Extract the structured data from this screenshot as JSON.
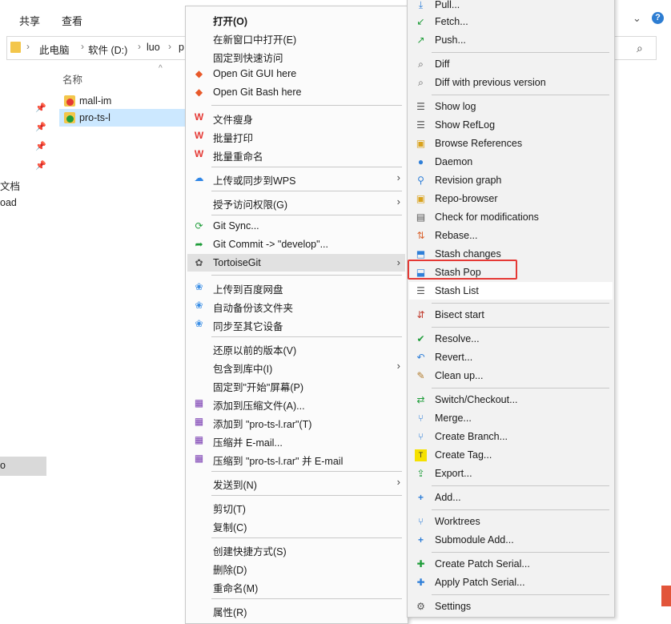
{
  "explorer": {
    "ribbon_tabs": [
      "共享",
      "查看"
    ],
    "breadcrumb": [
      "此电脑",
      "软件 (D:)",
      "luo",
      "p"
    ],
    "column_name": "名称",
    "files": [
      {
        "name": "mall-im",
        "selected": false,
        "badge": "#e53935"
      },
      {
        "name": "pro-ts-l",
        "selected": true,
        "badge": "#1f9d3a"
      }
    ],
    "nav_fragments": [
      "文档",
      "oad",
      "o"
    ]
  },
  "context_menu": {
    "items": [
      {
        "type": "item",
        "label": "打开(O)",
        "bold": true,
        "icon": "none"
      },
      {
        "type": "item",
        "label": "在新窗口中打开(E)",
        "icon": "none"
      },
      {
        "type": "item",
        "label": "固定到快速访问",
        "icon": "none"
      },
      {
        "type": "item",
        "label": "Open Git GUI here",
        "icon": "git-gui-icon"
      },
      {
        "type": "item",
        "label": "Open Git Bash here",
        "icon": "git-bash-icon"
      },
      {
        "type": "sep"
      },
      {
        "type": "item",
        "label": "文件瘦身",
        "icon": "wps-icon"
      },
      {
        "type": "item",
        "label": "批量打印",
        "icon": "wps-icon"
      },
      {
        "type": "item",
        "label": "批量重命名",
        "icon": "wps-icon"
      },
      {
        "type": "sep"
      },
      {
        "type": "item",
        "label": "上传或同步到WPS",
        "icon": "cloud-icon",
        "submenu": true
      },
      {
        "type": "sep"
      },
      {
        "type": "item",
        "label": "授予访问权限(G)",
        "icon": "none",
        "submenu": true
      },
      {
        "type": "sep"
      },
      {
        "type": "item",
        "label": "Git Sync...",
        "icon": "git-sync-icon"
      },
      {
        "type": "item",
        "label": "Git Commit -> \"develop\"...",
        "icon": "git-commit-icon"
      },
      {
        "type": "item",
        "label": "TortoiseGit",
        "icon": "tortoisegit-icon",
        "submenu": true,
        "highlighted": true
      },
      {
        "type": "sep"
      },
      {
        "type": "item",
        "label": "上传到百度网盘",
        "icon": "baidu-icon"
      },
      {
        "type": "item",
        "label": "自动备份该文件夹",
        "icon": "baidu-icon"
      },
      {
        "type": "item",
        "label": "同步至其它设备",
        "icon": "baidu-icon"
      },
      {
        "type": "sep"
      },
      {
        "type": "item",
        "label": "还原以前的版本(V)",
        "icon": "none"
      },
      {
        "type": "item",
        "label": "包含到库中(I)",
        "icon": "none",
        "submenu": true
      },
      {
        "type": "item",
        "label": "固定到\"开始\"屏幕(P)",
        "icon": "none"
      },
      {
        "type": "item",
        "label": "添加到压缩文件(A)...",
        "icon": "winrar-icon"
      },
      {
        "type": "item",
        "label": "添加到 \"pro-ts-l.rar\"(T)",
        "icon": "winrar-icon"
      },
      {
        "type": "item",
        "label": "压缩并 E-mail...",
        "icon": "winrar-icon"
      },
      {
        "type": "item",
        "label": "压缩到 \"pro-ts-l.rar\" 并 E-mail",
        "icon": "winrar-icon"
      },
      {
        "type": "sep"
      },
      {
        "type": "item",
        "label": "发送到(N)",
        "icon": "none",
        "submenu": true
      },
      {
        "type": "sep"
      },
      {
        "type": "item",
        "label": "剪切(T)",
        "icon": "none"
      },
      {
        "type": "item",
        "label": "复制(C)",
        "icon": "none"
      },
      {
        "type": "sep"
      },
      {
        "type": "item",
        "label": "创建快捷方式(S)",
        "icon": "none"
      },
      {
        "type": "item",
        "label": "删除(D)",
        "icon": "none"
      },
      {
        "type": "item",
        "label": "重命名(M)",
        "icon": "none"
      },
      {
        "type": "sep"
      },
      {
        "type": "item",
        "label": "属性(R)",
        "icon": "none"
      }
    ]
  },
  "tortoisegit_menu": {
    "items": [
      {
        "type": "item",
        "label": "Pull...",
        "icon": "pull-icon"
      },
      {
        "type": "item",
        "label": "Fetch...",
        "icon": "fetch-icon"
      },
      {
        "type": "item",
        "label": "Push...",
        "icon": "push-icon"
      },
      {
        "type": "sep"
      },
      {
        "type": "item",
        "label": "Diff",
        "icon": "diff-icon"
      },
      {
        "type": "item",
        "label": "Diff with previous version",
        "icon": "diff-icon"
      },
      {
        "type": "sep"
      },
      {
        "type": "item",
        "label": "Show log",
        "icon": "log-icon"
      },
      {
        "type": "item",
        "label": "Show RefLog",
        "icon": "log-icon"
      },
      {
        "type": "item",
        "label": "Browse References",
        "icon": "references-icon"
      },
      {
        "type": "item",
        "label": "Daemon",
        "icon": "daemon-icon"
      },
      {
        "type": "item",
        "label": "Revision graph",
        "icon": "revision-graph-icon"
      },
      {
        "type": "item",
        "label": "Repo-browser",
        "icon": "repo-browser-icon"
      },
      {
        "type": "item",
        "label": "Check for modifications",
        "icon": "check-modifications-icon"
      },
      {
        "type": "item",
        "label": "Rebase...",
        "icon": "rebase-icon"
      },
      {
        "type": "item",
        "label": "Stash changes",
        "icon": "stash-icon"
      },
      {
        "type": "item",
        "label": "Stash Pop",
        "icon": "stash-pop-icon",
        "highlighted_box": true
      },
      {
        "type": "item",
        "label": "Stash List",
        "icon": "log-icon",
        "white": true
      },
      {
        "type": "sep"
      },
      {
        "type": "item",
        "label": "Bisect start",
        "icon": "bisect-icon"
      },
      {
        "type": "sep"
      },
      {
        "type": "item",
        "label": "Resolve...",
        "icon": "resolve-icon"
      },
      {
        "type": "item",
        "label": "Revert...",
        "icon": "revert-icon"
      },
      {
        "type": "item",
        "label": "Clean up...",
        "icon": "cleanup-icon"
      },
      {
        "type": "sep"
      },
      {
        "type": "item",
        "label": "Switch/Checkout...",
        "icon": "switch-icon"
      },
      {
        "type": "item",
        "label": "Merge...",
        "icon": "merge-icon"
      },
      {
        "type": "item",
        "label": "Create Branch...",
        "icon": "branch-icon"
      },
      {
        "type": "item",
        "label": "Create Tag...",
        "icon": "tag-icon"
      },
      {
        "type": "item",
        "label": "Export...",
        "icon": "export-icon"
      },
      {
        "type": "sep"
      },
      {
        "type": "item",
        "label": "Add...",
        "icon": "add-icon"
      },
      {
        "type": "sep"
      },
      {
        "type": "item",
        "label": "Worktrees",
        "icon": "worktree-icon"
      },
      {
        "type": "item",
        "label": "Submodule Add...",
        "icon": "add-icon"
      },
      {
        "type": "sep"
      },
      {
        "type": "item",
        "label": "Create Patch Serial...",
        "icon": "patch-icon"
      },
      {
        "type": "item",
        "label": "Apply Patch Serial...",
        "icon": "patch-apply-icon"
      },
      {
        "type": "sep"
      },
      {
        "type": "item",
        "label": "Settings",
        "icon": "settings-icon"
      }
    ]
  },
  "colors": {
    "selection": "#cce8ff",
    "highlight_box": "#e53935",
    "menu_hover": "#e1e1e1"
  }
}
